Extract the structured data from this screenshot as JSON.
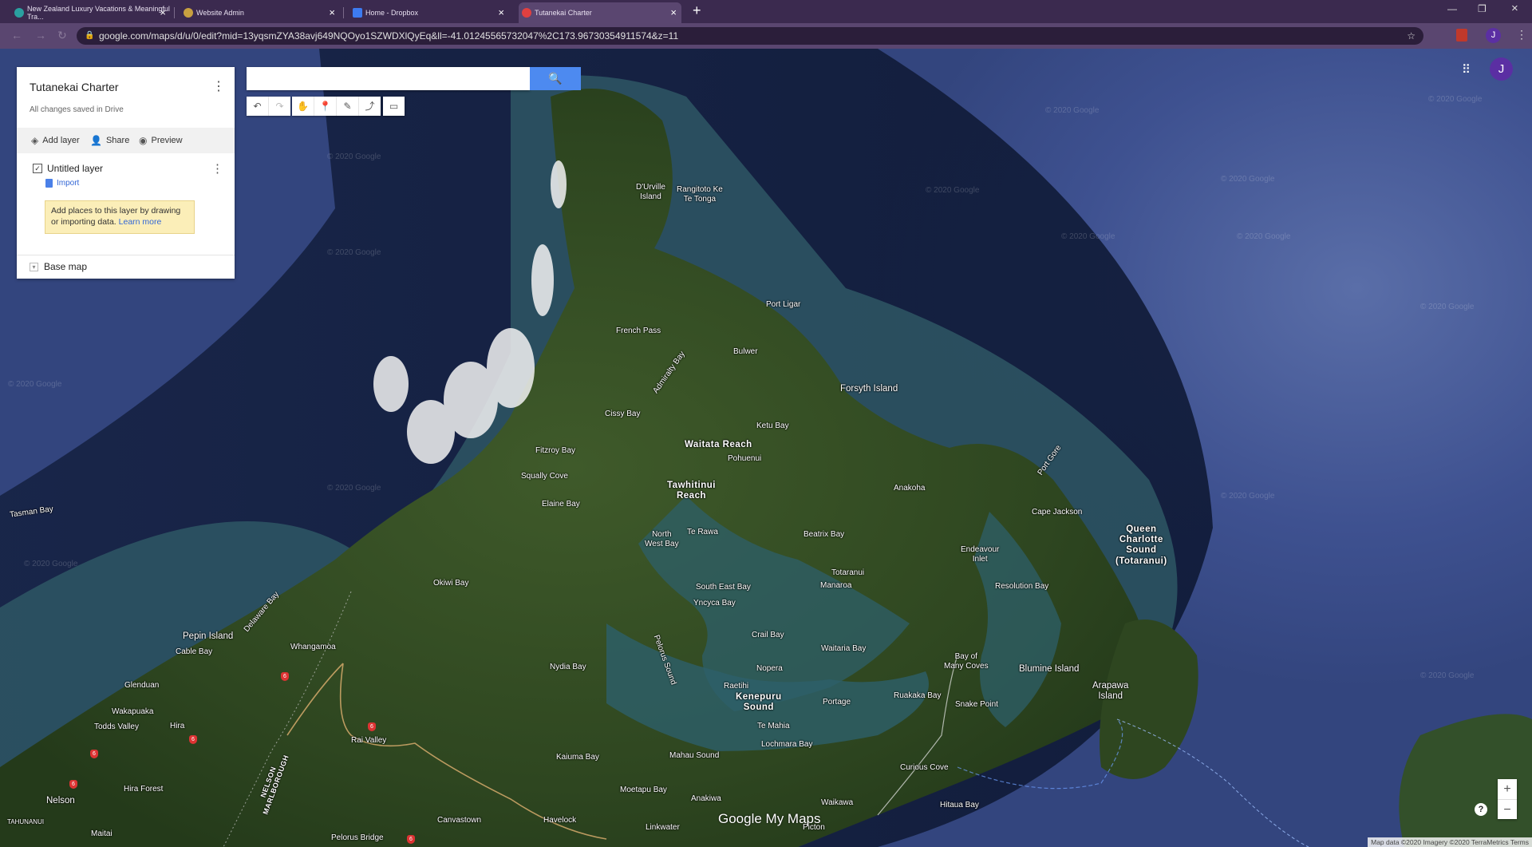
{
  "browser": {
    "tabs": [
      {
        "title": "New Zealand Luxury Vacations & Meaningful Tra..."
      },
      {
        "title": "Website Admin"
      },
      {
        "title": "Home - Dropbox"
      },
      {
        "title": "Tutanekai Charter"
      }
    ],
    "url": "google.com/maps/d/u/0/edit?mid=13yqsmZYA38avj649NQOyo1SZWDXlQyEq&ll=-41.01245565732047%2C173.96730354911574&z=11",
    "profile_initial": "J"
  },
  "panel": {
    "title": "Tutanekai Charter",
    "saved_status": "All changes saved in Drive",
    "add_layer": "Add layer",
    "share": "Share",
    "preview": "Preview",
    "layer_name": "Untitled layer",
    "import": "Import",
    "tip_text": "Add places to this layer by drawing or importing data.",
    "tip_link": "Learn more",
    "base_map": "Base map"
  },
  "toolbar": {
    "search_placeholder": "",
    "buttons": [
      "undo-icon",
      "redo-icon",
      "hand-icon",
      "marker-icon",
      "draw-line-icon",
      "directions-icon",
      "ruler-icon"
    ]
  },
  "map": {
    "labels": {
      "durville": "D'Urville\nIsland",
      "rangitoto": "Rangitoto Ke\nTe Tonga",
      "port_ligar": "Port Ligar",
      "french_pass": "French Pass",
      "admiralty_bay": "Admiralty Bay",
      "bulwer": "Bulwer",
      "forsyth": "Forsyth Island",
      "cissy_bay": "Cissy Bay",
      "ketu_bay": "Ketu Bay",
      "waitata": "Waitata Reach",
      "pohuenui": "Pohuenui",
      "fitzroy": "Fitzroy Bay",
      "port_gore": "Port Gore",
      "squally": "Squally Cove",
      "tawhitinui": "Tawhitinui\nReach",
      "anakoha": "Anakoha",
      "elaine": "Elaine Bay",
      "cape_jackson": "Cape Jackson",
      "tasman_bay": "Tasman Bay",
      "queen_charlotte": "Queen\nCharlotte\nSound\n(Totaranui)",
      "north_west_bay": "North\nWest Bay",
      "te_rawa": "Te Rawa",
      "beatrix": "Beatrix Bay",
      "endeavour": "Endeavour\nInlet",
      "totaranui": "Totaranui",
      "manaroa": "Manaroa",
      "okiwi": "Okiwi Bay",
      "south_east_bay": "South East Bay",
      "resolution": "Resolution Bay",
      "delaware": "Delaware Bay",
      "yncyca": "Yncyca Bay",
      "pepin": "Pepin Island",
      "cable_bay": "Cable Bay",
      "whangamoa": "Whangamoa",
      "crail": "Crail Bay",
      "waitaria": "Waitaria Bay",
      "pelorus_sound": "Pelorus Sound",
      "bay_many_coves": "Bay of\nMany Coves",
      "nydia": "Nydia Bay",
      "nopera": "Nopera",
      "blumine": "Blumine Island",
      "glenduan": "Glenduan",
      "raetihi": "Raetihi",
      "arapawa": "Arapawa\nIsland",
      "wakapuaka": "Wakapuaka",
      "kenepuru": "Kenepuru\nSound",
      "portage": "Portage",
      "ruakaka": "Ruakaka Bay",
      "snake_point": "Snake Point",
      "todds_valley": "Todds Valley",
      "hira": "Hira",
      "te_mahia": "Te Mahia",
      "rai_valley": "Rai Valley",
      "lochmara": "Lochmara Bay",
      "nelson_marlborough": "NELSON\nMARLBOROUGH",
      "kaiuma": "Kaiuma Bay",
      "mahau": "Mahau Sound",
      "curious_cove": "Curious Cove",
      "hira_forest": "Hira Forest",
      "moetapu": "Moetapu Bay",
      "nelson": "Nelson",
      "anakiwa": "Anakiwa",
      "waikawa": "Waikawa",
      "hitaua": "Hitaua Bay",
      "tahunanui": "TAHUNANUI",
      "canvastown": "Canvastown",
      "havelock": "Havelock",
      "linkwater": "Linkwater",
      "picton": "Picton",
      "maitai": "Maitai",
      "pelorus_bridge": "Pelorus Bridge"
    },
    "route_shield": "6",
    "watermark": "© 2020 Google",
    "logo": "Google My Maps",
    "attribution": "Map data ©2020 Imagery ©2020 TerraMetrics   Terms",
    "zoom_in": "+",
    "zoom_out": "−",
    "help": "?"
  },
  "colors": {
    "accent": "#4d8af0",
    "tab_bar": "#3b2a4f",
    "tip_bg": "#fbeeb8",
    "sea": "#3e5190"
  }
}
